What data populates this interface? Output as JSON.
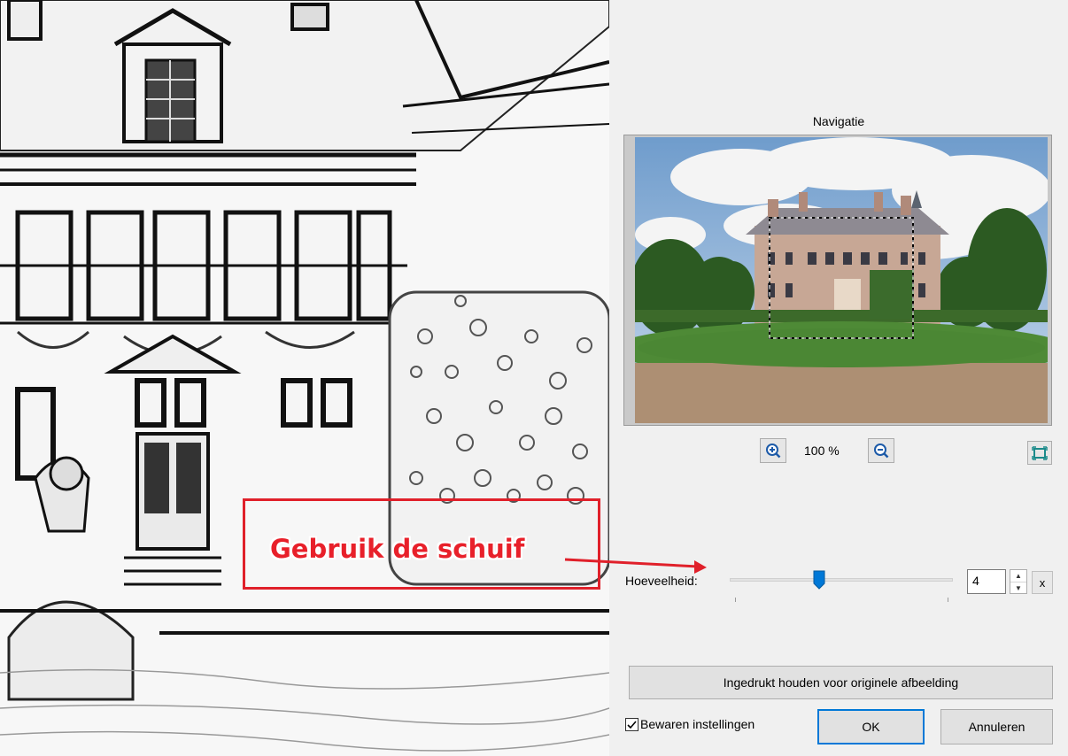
{
  "navigation": {
    "title": "Navigatie",
    "zoom_level": "100 %"
  },
  "settings": {
    "amount_label": "Hoeveelheid:",
    "amount_value": "4",
    "reset_label": "x"
  },
  "buttons": {
    "hold_original": "Ingedrukt houden voor originele afbeelding",
    "ok": "OK",
    "cancel": "Annuleren"
  },
  "keep_settings": {
    "label": "Bewaren instellingen",
    "checked": true
  },
  "annotation": {
    "text": "Gebruik de schuif",
    "color": "#e8202a"
  },
  "icons": {
    "zoom_in": "zoom-in-icon",
    "zoom_out": "zoom-out-icon",
    "fit": "fit-to-window-icon",
    "spin_up": "spin-up-icon",
    "spin_down": "spin-down-icon"
  }
}
